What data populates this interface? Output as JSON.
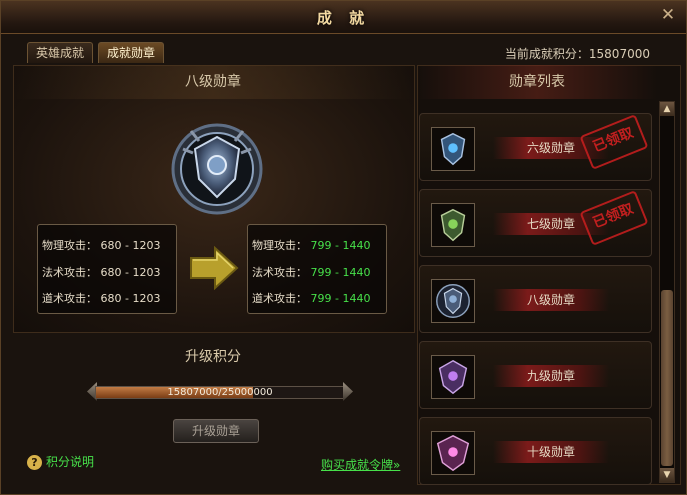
{
  "window": {
    "title": "成 就"
  },
  "tabs": [
    {
      "label": "英雄成就",
      "active": false
    },
    {
      "label": "成就勋章",
      "active": true
    }
  ],
  "points_label": "当前成就积分：15807000",
  "current_medal": {
    "title": "八级勋章",
    "current_stats": [
      {
        "label": "物理攻击：",
        "value": "680 - 1203"
      },
      {
        "label": "法术攻击：",
        "value": "680 - 1203"
      },
      {
        "label": "道术攻击：",
        "value": "680 - 1203"
      }
    ],
    "next_stats": [
      {
        "label": "物理攻击：",
        "value": "799 - 1440"
      },
      {
        "label": "法术攻击：",
        "value": "799 - 1440"
      },
      {
        "label": "道术攻击：",
        "value": "799 - 1440"
      }
    ]
  },
  "upgrade": {
    "heading": "升级积分",
    "progress_text": "15807000/25000000",
    "progress_fraction": 0.6323,
    "button_label": "升级勋章"
  },
  "footer": {
    "help_label": "积分说明",
    "buy_link": "购买成就令牌»"
  },
  "medal_list": {
    "header": "勋章列表",
    "items": [
      {
        "name": "六级勋章",
        "stamp": "已领取",
        "icon": "medal-blue-icon"
      },
      {
        "name": "七级勋章",
        "stamp": "已领取",
        "icon": "medal-green-icon"
      },
      {
        "name": "八级勋章",
        "stamp": "",
        "icon": "medal-silver-icon"
      },
      {
        "name": "九级勋章",
        "stamp": "",
        "icon": "medal-purple-icon"
      },
      {
        "name": "十级勋章",
        "stamp": "",
        "icon": "medal-violet-icon"
      }
    ]
  },
  "colors": {
    "stat_green": "#47e04a",
    "stamp_red": "#c31e1e",
    "accent_gold": "#f3d9a1"
  }
}
